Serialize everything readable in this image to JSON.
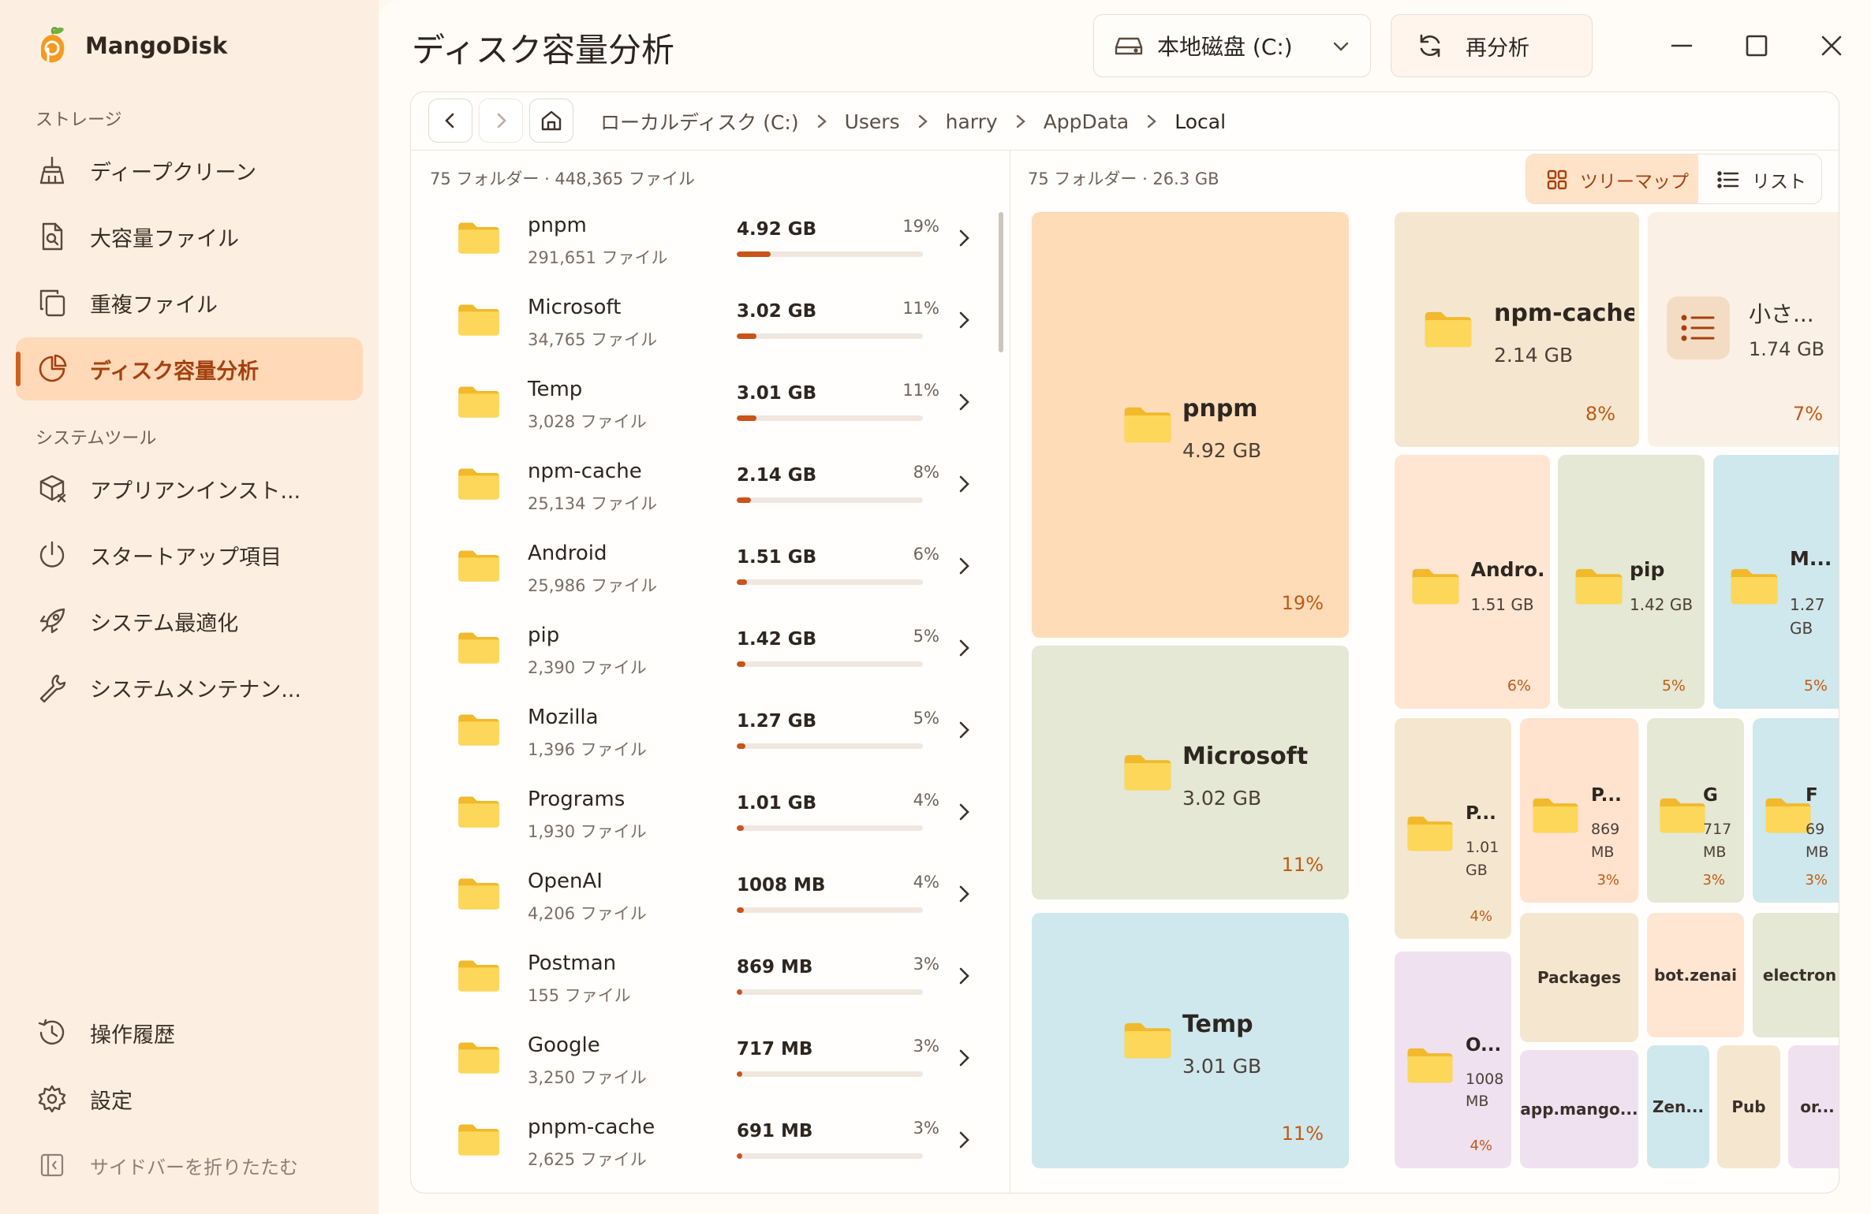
{
  "app": {
    "name": "MangoDisk"
  },
  "sidebar": {
    "section_storage": "ストレージ",
    "section_tools": "システムツール",
    "items": [
      {
        "label": "ディープクリーン"
      },
      {
        "label": "大容量ファイル"
      },
      {
        "label": "重複ファイル"
      },
      {
        "label": "ディスク容量分析"
      },
      {
        "label": "アプリアンインスト..."
      },
      {
        "label": "スタートアップ項目"
      },
      {
        "label": "システム最適化"
      },
      {
        "label": "システムメンテナン..."
      }
    ],
    "history": "操作履歴",
    "settings": "設定",
    "collapse": "サイドバーを折りたたむ"
  },
  "header": {
    "title": "ディスク容量分析",
    "drive": "本地磁盘 (C:)",
    "reanalyze": "再分析"
  },
  "breadcrumb": [
    "ローカルディスク (C:)",
    "Users",
    "harry",
    "AppData",
    "Local"
  ],
  "list": {
    "meta": "75 フォルダー · 448,365 ファイル",
    "rows": [
      {
        "name": "pnpm",
        "count": "291,651 ファイル",
        "size": "4.92 GB",
        "pct": "19%"
      },
      {
        "name": "Microsoft",
        "count": "34,765 ファイル",
        "size": "3.02 GB",
        "pct": "11%"
      },
      {
        "name": "Temp",
        "count": "3,028 ファイル",
        "size": "3.01 GB",
        "pct": "11%"
      },
      {
        "name": "npm-cache",
        "count": "25,134 ファイル",
        "size": "2.14 GB",
        "pct": "8%"
      },
      {
        "name": "Android",
        "count": "25,986 ファイル",
        "size": "1.51 GB",
        "pct": "6%"
      },
      {
        "name": "pip",
        "count": "2,390 ファイル",
        "size": "1.42 GB",
        "pct": "5%"
      },
      {
        "name": "Mozilla",
        "count": "1,396 ファイル",
        "size": "1.27 GB",
        "pct": "5%"
      },
      {
        "name": "Programs",
        "count": "1,930 ファイル",
        "size": "1.01 GB",
        "pct": "4%"
      },
      {
        "name": "OpenAI",
        "count": "4,206 ファイル",
        "size": "1008 MB",
        "pct": "4%"
      },
      {
        "name": "Postman",
        "count": "155 ファイル",
        "size": "869 MB",
        "pct": "3%"
      },
      {
        "name": "Google",
        "count": "3,250 ファイル",
        "size": "717 MB",
        "pct": "3%"
      },
      {
        "name": "pnpm-cache",
        "count": "2,625 ファイル",
        "size": "691 MB",
        "pct": "3%"
      }
    ]
  },
  "treemap": {
    "meta": "75 フォルダー · 26.3 GB",
    "view_treemap": "ツリーマップ",
    "view_list": "リスト",
    "tiles": [
      {
        "name": "pnpm",
        "size": "4.92 GB",
        "pct": "19%"
      },
      {
        "name": "npm-cache",
        "size": "2.14 GB",
        "pct": "8%"
      },
      {
        "name": "小さ...",
        "size": "1.74 GB",
        "pct": "7%"
      },
      {
        "name": "Microsoft",
        "size": "3.02 GB",
        "pct": "11%"
      },
      {
        "name": "Andro...",
        "size": "1.51 GB",
        "pct": "6%"
      },
      {
        "name": "pip",
        "size": "1.42 GB",
        "pct": "5%"
      },
      {
        "name": "M...",
        "size": "1.27 GB",
        "pct": "5%"
      },
      {
        "name": "P...",
        "size": "1.01 GB",
        "pct": "4%"
      },
      {
        "name": "P...",
        "size": "869 MB",
        "pct": "3%"
      },
      {
        "name": "G",
        "size": "717 MB",
        "pct": "3%"
      },
      {
        "name": "F",
        "size": "69 MB",
        "pct": "3%"
      },
      {
        "name": "Temp",
        "size": "3.01 GB",
        "pct": "11%"
      },
      {
        "name": "O...",
        "size": "1008 MB",
        "pct": "4%"
      },
      {
        "name": "Packages"
      },
      {
        "name": "bot.zenai"
      },
      {
        "name": "electron"
      },
      {
        "name": "app.mango..."
      },
      {
        "name": "Zen..."
      },
      {
        "name": "Pub"
      },
      {
        "name": "or..."
      }
    ]
  },
  "colors": {
    "accent": "#c8541a",
    "active_bg": "#ffd9b8",
    "tile_orange": "#ffdcb8",
    "tile_beige": "#f5e7cf",
    "tile_green": "#e4e8d4",
    "tile_blue": "#cfe8ee",
    "tile_purple": "#f0e1f1"
  },
  "icons": [
    "mango-logo-icon",
    "broom-icon",
    "file-search-icon",
    "copy-icon",
    "pie-chart-icon",
    "box-x-icon",
    "power-icon",
    "rocket-icon",
    "wrench-icon",
    "history-icon",
    "gear-icon",
    "sidebar-collapse-icon",
    "drive-icon",
    "chevron-down-icon",
    "refresh-icon",
    "minimize-icon",
    "maximize-icon",
    "close-icon",
    "back-icon",
    "forward-icon",
    "home-icon",
    "folder-icon",
    "grid-icon",
    "list-icon"
  ]
}
